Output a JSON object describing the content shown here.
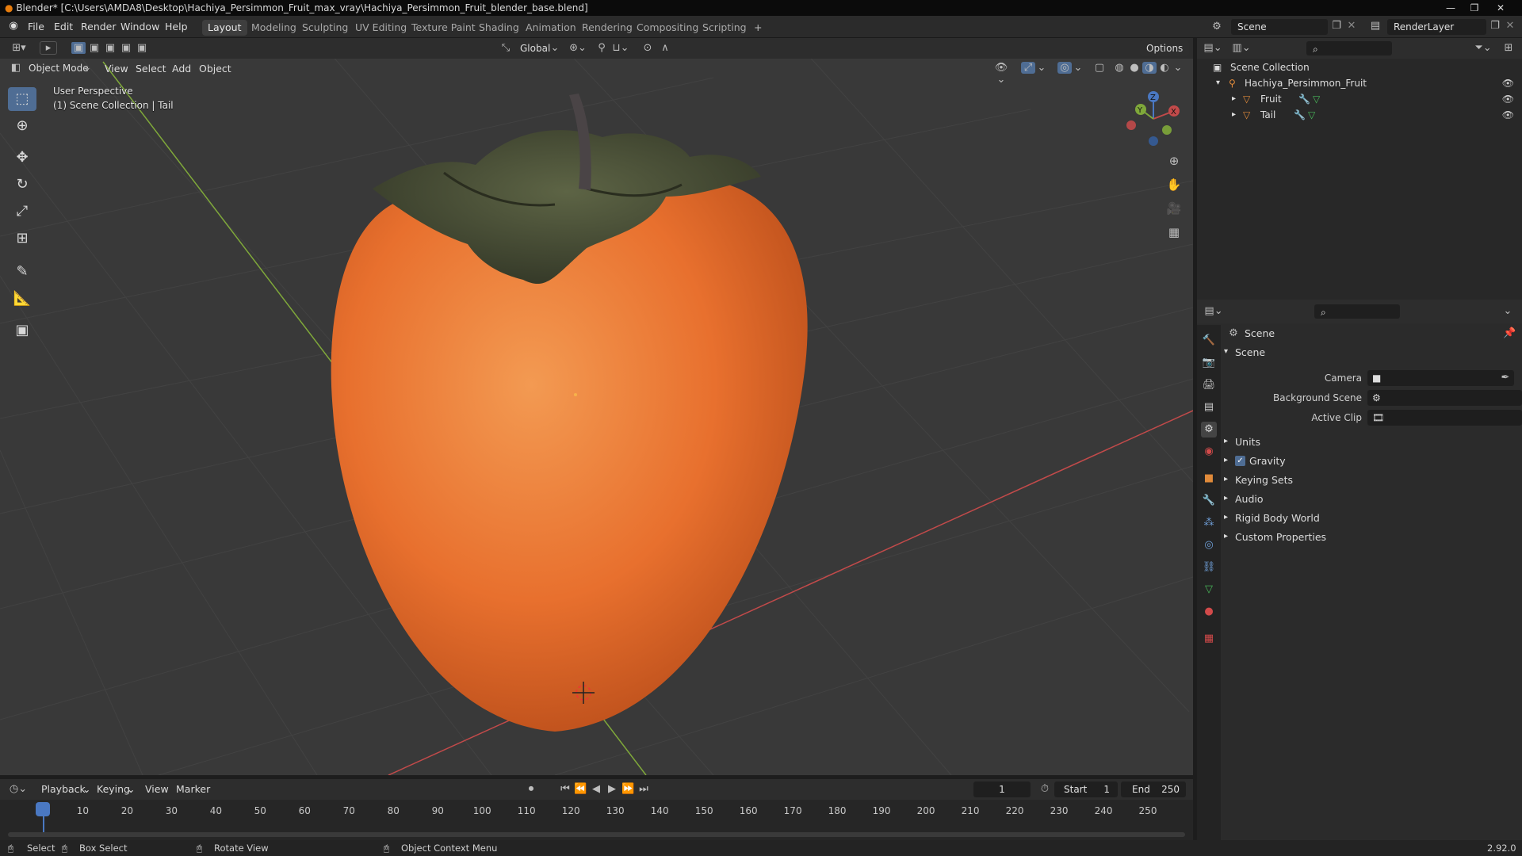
{
  "window": {
    "title": "Blender* [C:\\Users\\AMDA8\\Desktop\\Hachiya_Persimmon_Fruit_max_vray\\Hachiya_Persimmon_Fruit_blender_base.blend]",
    "minimize": "—",
    "maximize": "❐",
    "close": "✕"
  },
  "menu": [
    "File",
    "Edit",
    "Render",
    "Window",
    "Help"
  ],
  "workspaces": [
    "Layout",
    "Modeling",
    "Sculpting",
    "UV Editing",
    "Texture Paint",
    "Shading",
    "Animation",
    "Rendering",
    "Compositing",
    "Scripting"
  ],
  "active_workspace": "Layout",
  "add_workspace": "+",
  "scene_field": "Scene",
  "renderlayer_field": "RenderLayer",
  "viewport": {
    "transform_orientation": "Global",
    "options": "Options",
    "mode": "Object Mode",
    "header_menus": [
      "View",
      "Select",
      "Add",
      "Object"
    ],
    "overlay_line1": "User Perspective",
    "overlay_line2": "(1) Scene Collection | Tail",
    "gizmo_axes": [
      "X",
      "Y",
      "Z"
    ]
  },
  "outliner": {
    "root": "Scene Collection",
    "collection": "Hachiya_Persimmon_Fruit",
    "items": [
      "Fruit",
      "Tail"
    ]
  },
  "properties": {
    "breadcrumb": "Scene",
    "panel_title": "Scene",
    "fields": [
      {
        "label": "Camera",
        "value": ""
      },
      {
        "label": "Background Scene",
        "value": ""
      },
      {
        "label": "Active Clip",
        "value": ""
      }
    ],
    "sections": [
      "Units",
      "Gravity",
      "Keying Sets",
      "Audio",
      "Rigid Body World",
      "Custom Properties"
    ],
    "gravity_checked": true
  },
  "timeline": {
    "menus": [
      "Playback",
      "Keying",
      "View",
      "Marker"
    ],
    "current_frame": "1",
    "start_label": "Start",
    "start_value": "1",
    "end_label": "End",
    "end_value": "250",
    "ticks": [
      "1",
      "10",
      "20",
      "30",
      "40",
      "50",
      "60",
      "70",
      "80",
      "90",
      "100",
      "110",
      "120",
      "130",
      "140",
      "150",
      "160",
      "170",
      "180",
      "190",
      "200",
      "210",
      "220",
      "230",
      "240",
      "250"
    ]
  },
  "statusbar": {
    "select": "Select",
    "box_select": "Box Select",
    "rotate_view": "Rotate View",
    "context_menu": "Object Context Menu",
    "version": "2.92.0"
  },
  "colors": {
    "accent": "#4f6d94",
    "fruit": "#e8702e",
    "leaf": "#4a5038",
    "axis_x": "#c24a4a",
    "axis_y": "#7fa83a",
    "playhead": "#4a78c2"
  }
}
